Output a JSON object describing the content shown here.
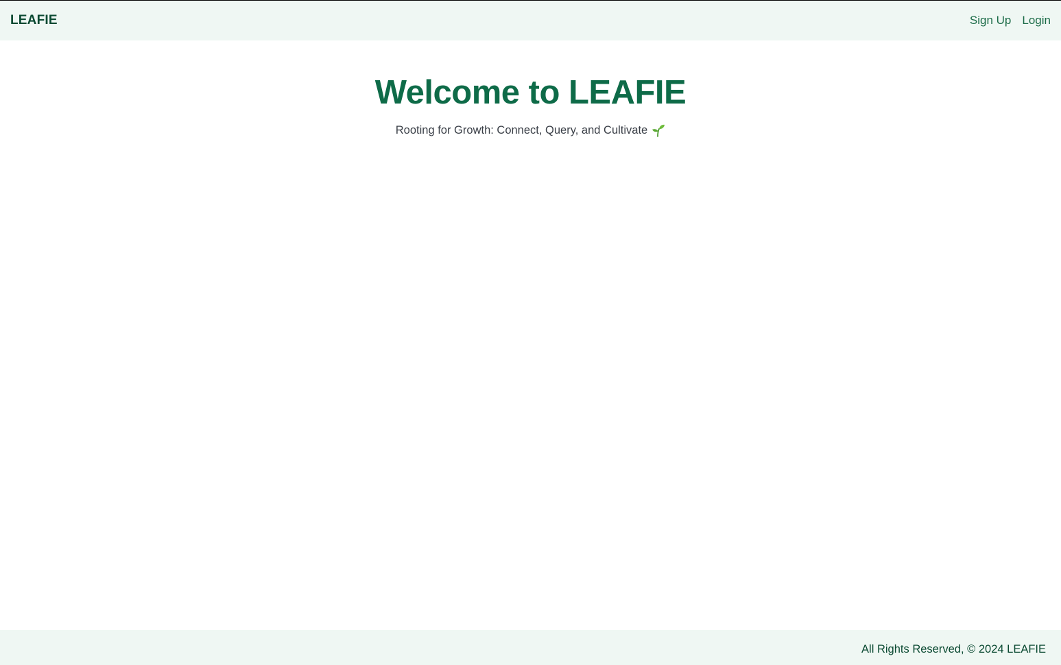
{
  "header": {
    "brand": "LEAFIE",
    "nav": {
      "signup_label": "Sign Up",
      "login_label": "Login"
    }
  },
  "hero": {
    "title": "Welcome to LEAFIE",
    "subtitle": "Rooting for Growth: Connect, Query, and Cultivate",
    "subtitle_icon": "sprout-icon"
  },
  "footer": {
    "text": "All Rights Reserved, © 2024 LEAFIE"
  },
  "colors": {
    "brand_dark": "#0b4a32",
    "accent_green": "#0e6b48",
    "link_green": "#1b6b47",
    "bar_background": "#eff7f3"
  }
}
